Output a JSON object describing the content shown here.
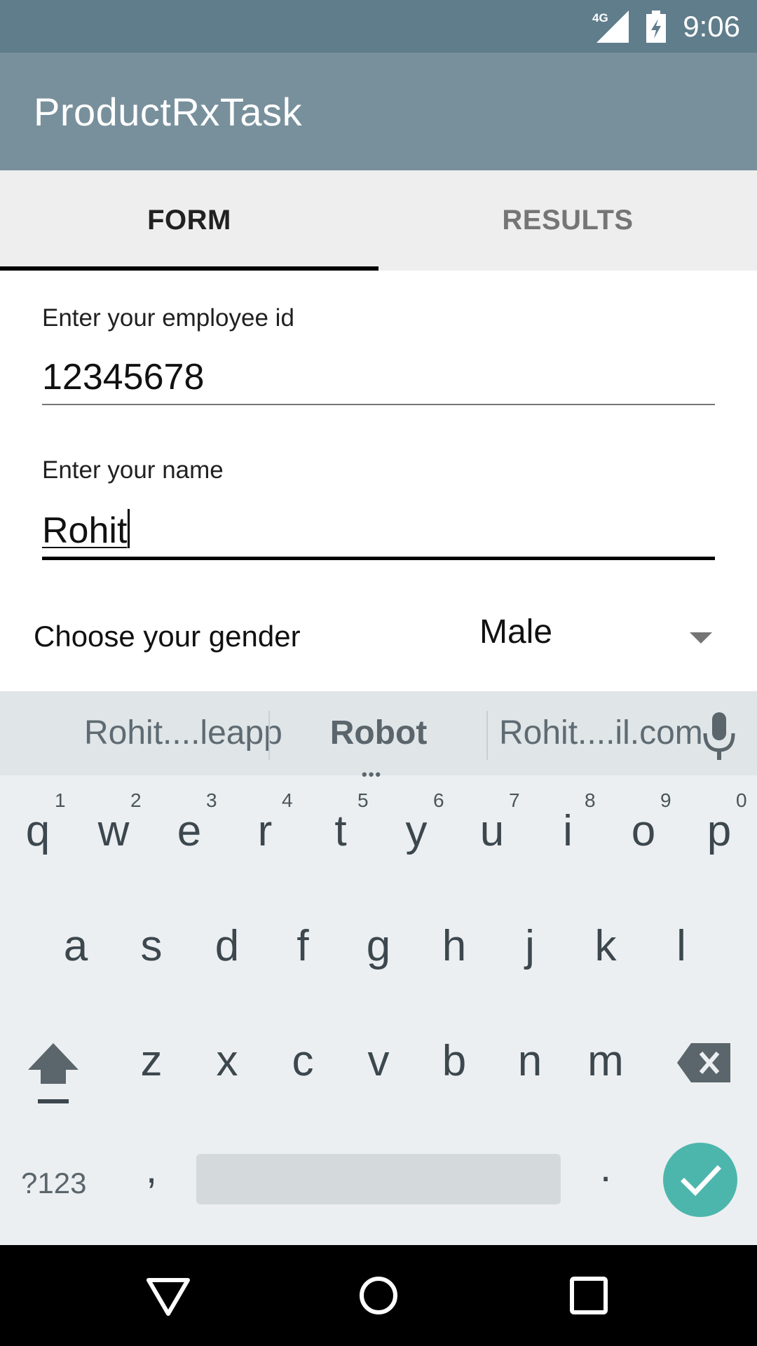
{
  "status_bar": {
    "time": "9:06",
    "network_label": "4G",
    "icons": [
      "signal-icon",
      "battery-charging-icon"
    ]
  },
  "app_bar": {
    "title": "ProductRxTask"
  },
  "tabs": [
    {
      "label": "FORM",
      "active": true
    },
    {
      "label": "RESULTS",
      "active": false
    }
  ],
  "form": {
    "employee_id": {
      "label": "Enter your employee id",
      "value": "12345678"
    },
    "name": {
      "label": "Enter your name",
      "value": "Rohit"
    },
    "gender": {
      "label": "Choose your gender",
      "selected": "Male"
    }
  },
  "keyboard": {
    "suggestions": [
      "Rohit....leapp",
      "Robot",
      "Rohit....il.com"
    ],
    "rows": [
      [
        "q",
        "w",
        "e",
        "r",
        "t",
        "y",
        "u",
        "i",
        "o",
        "p"
      ],
      [
        "a",
        "s",
        "d",
        "f",
        "g",
        "h",
        "j",
        "k",
        "l"
      ],
      [
        "z",
        "x",
        "c",
        "v",
        "b",
        "n",
        "m"
      ]
    ],
    "hints": [
      "1",
      "2",
      "3",
      "4",
      "5",
      "6",
      "7",
      "8",
      "9",
      "0"
    ],
    "symbols_key": "?123",
    "comma_key": ",",
    "period_key": ".",
    "accent_color": "#4db6ac"
  },
  "nav_bar": {
    "buttons": [
      "back-icon",
      "home-icon",
      "recents-icon"
    ]
  }
}
